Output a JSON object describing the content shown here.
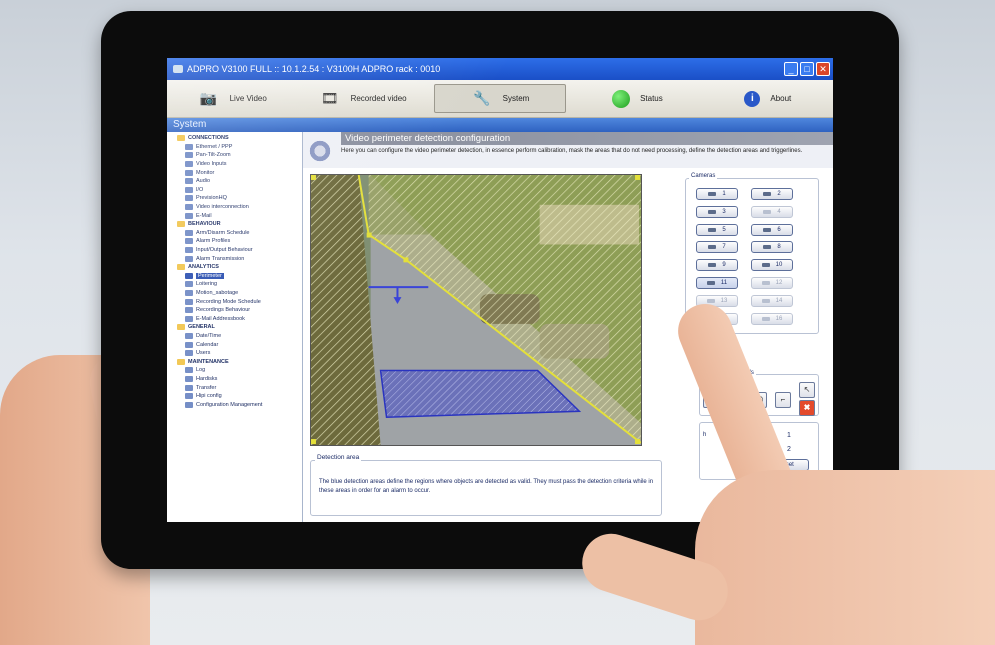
{
  "window": {
    "title": "ADPRO V3100 FULL :: 10.1.2.54 : V3100H ADPRO rack : 0010",
    "minimize": "_",
    "maximize": "□",
    "close": "✕"
  },
  "toolbar": {
    "items": [
      {
        "label": "Live Video",
        "icon": "camera-icon"
      },
      {
        "label": "Recorded video",
        "icon": "film-icon"
      },
      {
        "label": "System",
        "icon": "wrench-icon"
      },
      {
        "label": "Status",
        "icon": "status-green-icon"
      },
      {
        "label": "About",
        "icon": "info-icon"
      }
    ],
    "active_index": 2
  },
  "panel": {
    "title": "System"
  },
  "tree": {
    "rows": [
      {
        "label": "CONNECTIONS",
        "group": true
      },
      {
        "label": "Ethernet / PPP",
        "group": false
      },
      {
        "label": "Pan-Tilt-Zoom",
        "group": false
      },
      {
        "label": "Video Inputs",
        "group": false
      },
      {
        "label": "Monitor",
        "group": false
      },
      {
        "label": "Audio",
        "group": false
      },
      {
        "label": "I/O",
        "group": false
      },
      {
        "label": "PrevisionHQ",
        "group": false
      },
      {
        "label": "Video interconnection",
        "group": false
      },
      {
        "label": "E-Mail",
        "group": false
      },
      {
        "label": "BEHAVIOUR",
        "group": true
      },
      {
        "label": "Arm/Disarm Schedule",
        "group": false
      },
      {
        "label": "Alarm Profiles",
        "group": false
      },
      {
        "label": "Input/Output Behaviour",
        "group": false
      },
      {
        "label": "Alarm Transmission",
        "group": false
      },
      {
        "label": "ANALYTICS",
        "group": true
      },
      {
        "label": "Perimeter",
        "group": false,
        "selected": true
      },
      {
        "label": "Loitering",
        "group": false
      },
      {
        "label": "Motion_sabotage",
        "group": false
      },
      {
        "label": "Recording Mode Schedule",
        "group": false
      },
      {
        "label": "Recordings Behaviour",
        "group": false
      },
      {
        "label": "E-Mail Addressbook",
        "group": false
      },
      {
        "label": "GENERAL",
        "group": true
      },
      {
        "label": "Date/Time",
        "group": false
      },
      {
        "label": "Calendar",
        "group": false
      },
      {
        "label": "Users",
        "group": false
      },
      {
        "label": "MAINTENANCE",
        "group": true
      },
      {
        "label": "Log",
        "group": false
      },
      {
        "label": "Hardisks",
        "group": false
      },
      {
        "label": "Transfer",
        "group": false
      },
      {
        "label": "Hipi config",
        "group": false
      },
      {
        "label": "Configuration Management",
        "group": false
      }
    ]
  },
  "content": {
    "title": "Video perimeter detection configuration",
    "description": "Here you can configure the video perimeter detection, in essence perform calibration, mask the areas that do not need processing, define the detection areas and triggerlines."
  },
  "cameras": {
    "legend": "Cameras",
    "buttons": [
      {
        "label": "1",
        "enabled": true
      },
      {
        "label": "2",
        "enabled": true
      },
      {
        "label": "3",
        "enabled": true
      },
      {
        "label": "4",
        "enabled": false
      },
      {
        "label": "5",
        "enabled": true
      },
      {
        "label": "6",
        "enabled": true
      },
      {
        "label": "7",
        "enabled": true
      },
      {
        "label": "8",
        "enabled": true
      },
      {
        "label": "9",
        "enabled": true
      },
      {
        "label": "10",
        "enabled": true
      },
      {
        "label": "11",
        "enabled": true,
        "active": true
      },
      {
        "label": "12",
        "enabled": false
      },
      {
        "label": "13",
        "enabled": false
      },
      {
        "label": "14",
        "enabled": false
      },
      {
        "label": "15",
        "enabled": false
      },
      {
        "label": "16",
        "enabled": false
      }
    ]
  },
  "tools": {
    "legend": "g Tools",
    "buttons": [
      "arrow-cursor-icon",
      "delete-icon"
    ]
  },
  "stats": {
    "label1": "h",
    "value1": "1",
    "value2": "2",
    "reset": "Reset"
  },
  "detection": {
    "legend": "Detection area",
    "text": "The blue detection areas define the regions where objects are detected as valid. They must pass the detection criteria while in these areas in order for an alarm to occur."
  }
}
